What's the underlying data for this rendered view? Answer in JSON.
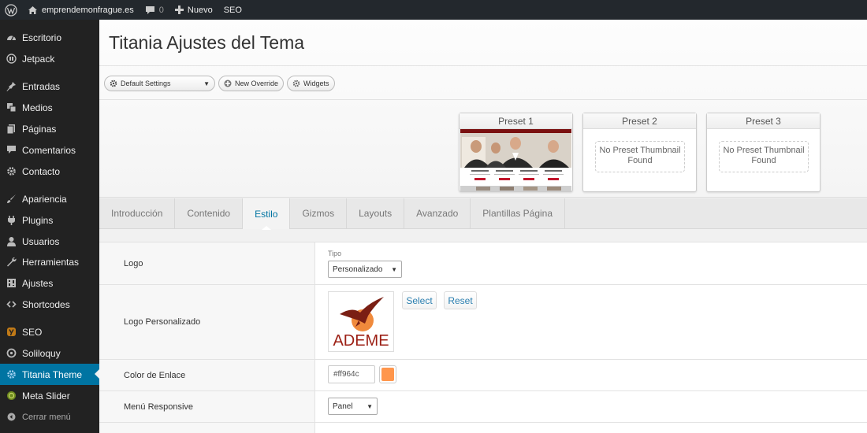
{
  "adminbar": {
    "site_name": "emprendemonfrague.es",
    "comments_count": "0",
    "new_label": "Nuevo",
    "seo_label": "SEO"
  },
  "sidebar": {
    "items": [
      {
        "label": "Escritorio",
        "icon": "dashboard-icon"
      },
      {
        "label": "Jetpack",
        "icon": "jetpack-icon"
      },
      {
        "label": "Entradas",
        "icon": "pin-icon"
      },
      {
        "label": "Medios",
        "icon": "media-icon"
      },
      {
        "label": "Páginas",
        "icon": "pages-icon"
      },
      {
        "label": "Comentarios",
        "icon": "comment-icon"
      },
      {
        "label": "Contacto",
        "icon": "gear-icon"
      },
      {
        "label": "Apariencia",
        "icon": "brush-icon"
      },
      {
        "label": "Plugins",
        "icon": "plugin-icon"
      },
      {
        "label": "Usuarios",
        "icon": "user-icon"
      },
      {
        "label": "Herramientas",
        "icon": "wrench-icon"
      },
      {
        "label": "Ajustes",
        "icon": "settings-icon"
      },
      {
        "label": "Shortcodes",
        "icon": "code-icon"
      },
      {
        "label": "SEO",
        "icon": "seo-icon"
      },
      {
        "label": "Soliloquy",
        "icon": "soliloquy-icon"
      },
      {
        "label": "Titania Theme",
        "icon": "theme-gear-icon",
        "active": true
      },
      {
        "label": "Meta Slider",
        "icon": "slider-icon"
      },
      {
        "label": "Cerrar menú",
        "icon": "collapse-icon"
      }
    ]
  },
  "page": {
    "title": "Titania Ajustes del Tema"
  },
  "toolbar": {
    "settings_select": "Default Settings",
    "new_override": "New Override",
    "widgets": "Widgets"
  },
  "presets": [
    {
      "title": "Preset 1",
      "empty_text": ""
    },
    {
      "title": "Preset 2",
      "empty_text": "No Preset Thumbnail Found"
    },
    {
      "title": "Preset 3",
      "empty_text": "No Preset Thumbnail Found"
    }
  ],
  "tabs": [
    {
      "label": "Introducción"
    },
    {
      "label": "Contenido"
    },
    {
      "label": "Estilo",
      "active": true
    },
    {
      "label": "Gizmos"
    },
    {
      "label": "Layouts"
    },
    {
      "label": "Avanzado"
    },
    {
      "label": "Plantillas Página"
    }
  ],
  "settings": {
    "logo": {
      "label": "Logo",
      "tipo_label": "Tipo",
      "tipo_value": "Personalizado"
    },
    "logo_custom": {
      "label": "Logo Personalizado",
      "logo_text": "ADEME",
      "select_label": "Select",
      "reset_label": "Reset"
    },
    "link_color": {
      "label": "Color de Enlace",
      "value": "#ff964c",
      "swatch": "#ff964c"
    },
    "responsive_menu": {
      "label": "Menú Responsive",
      "value": "Panel"
    }
  },
  "colors": {
    "adminbar_bg": "#23282d",
    "sidebar_bg": "#222222",
    "active_blue": "#0074a2",
    "link_blue": "#2a7fb0"
  }
}
